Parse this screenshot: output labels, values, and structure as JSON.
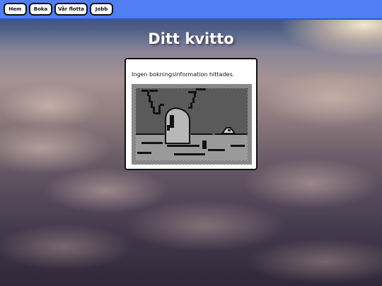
{
  "nav": {
    "items": [
      {
        "label": "Hem"
      },
      {
        "label": "Boka"
      },
      {
        "label": "Vår flotta"
      },
      {
        "label": "Jobb"
      }
    ]
  },
  "page": {
    "title": "Ditt kvitto"
  },
  "receipt": {
    "message": "Ingen bokningsinformation hittades."
  },
  "colors": {
    "navbar": "#4f7ff2",
    "title_text": "#ffffff",
    "card_background": "#ffffff"
  },
  "illustration": {
    "icon": "pixel-art-image-placeholder-icon"
  }
}
